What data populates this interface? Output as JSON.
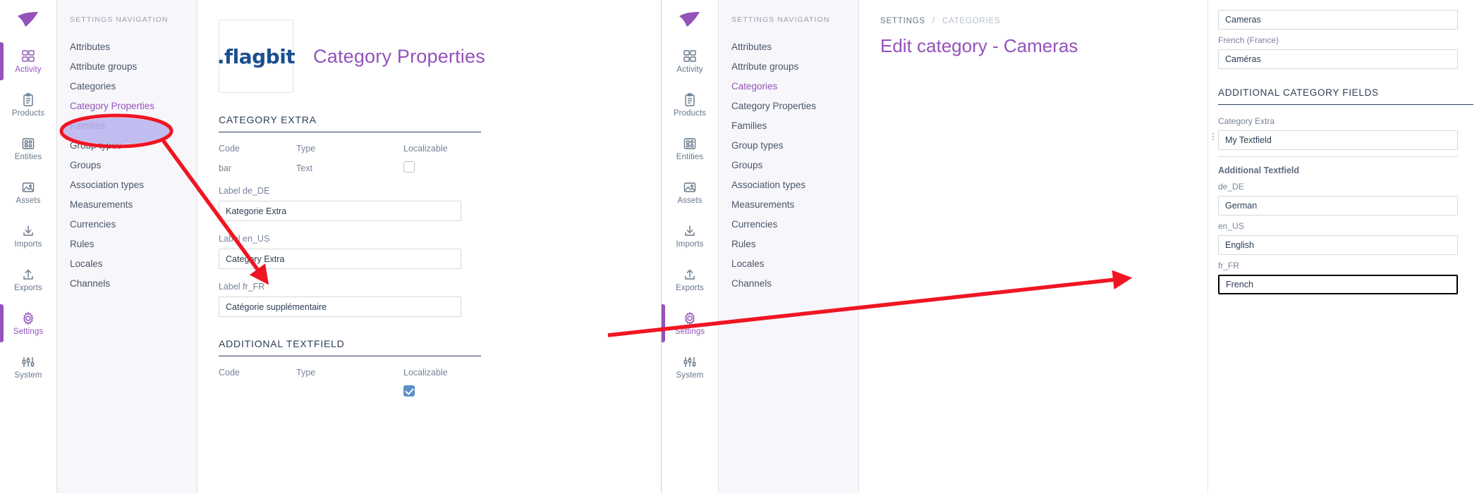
{
  "rail": {
    "logo_name": "akeneo-logo",
    "items": [
      {
        "label": "Activity",
        "icon": "grid-icon",
        "active_left": true,
        "active_right": false
      },
      {
        "label": "Products",
        "icon": "clipboard-icon",
        "active_left": false,
        "active_right": false
      },
      {
        "label": "Entities",
        "icon": "entities-grid-icon",
        "active_left": false,
        "active_right": false
      },
      {
        "label": "Assets",
        "icon": "image-icon",
        "active_left": false,
        "active_right": false
      },
      {
        "label": "Imports",
        "icon": "download-icon",
        "active_left": false,
        "active_right": false
      },
      {
        "label": "Exports",
        "icon": "upload-icon",
        "active_left": false,
        "active_right": false
      },
      {
        "label": "Settings",
        "icon": "gear-icon",
        "active_left": true,
        "active_right": true
      },
      {
        "label": "System",
        "icon": "sliders-icon",
        "active_left": false,
        "active_right": false
      }
    ]
  },
  "settings_nav": {
    "title": "SETTINGS NAVIGATION",
    "items": [
      {
        "label": "Attributes"
      },
      {
        "label": "Attribute groups"
      },
      {
        "label": "Categories"
      },
      {
        "label": "Category Properties"
      },
      {
        "label": "Families"
      },
      {
        "label": "Group types"
      },
      {
        "label": "Groups"
      },
      {
        "label": "Association types"
      },
      {
        "label": "Measurements"
      },
      {
        "label": "Currencies"
      },
      {
        "label": "Rules"
      },
      {
        "label": "Locales"
      },
      {
        "label": "Channels"
      }
    ],
    "active_left_index": 3,
    "active_right_index": 2
  },
  "properties_pane": {
    "logo_label": ".flagbit",
    "title": "Category Properties",
    "sections": [
      {
        "heading": "CATEGORY EXTRA",
        "columns": {
          "code": "Code",
          "type": "Type",
          "localizable": "Localizable"
        },
        "code_value": "bar",
        "type_value": "Text",
        "localizable_checked": false,
        "fields": [
          {
            "label": "Label de_DE",
            "value": "Kategorie Extra",
            "focus": false
          },
          {
            "label": "Label en_US",
            "value": "Category Extra",
            "focus": true
          },
          {
            "label": "Label fr_FR",
            "value": "Catégorie supplémentaire",
            "focus": false
          }
        ]
      },
      {
        "heading": "ADDITIONAL TEXTFIELD",
        "columns": {
          "code": "Code",
          "type": "Type",
          "localizable": "Localizable"
        },
        "code_value": "",
        "type_value": "",
        "localizable_checked": true,
        "fields": []
      }
    ]
  },
  "category_pane": {
    "breadcrumb": {
      "parent": "SETTINGS",
      "separator": "/",
      "current": "CATEGORIES"
    },
    "title": "Edit category - Cameras",
    "form": {
      "top_fields": [
        {
          "label": "",
          "value": "Cameras",
          "focus": false
        },
        {
          "label": "French (France)",
          "value": "Caméras",
          "focus": false
        }
      ],
      "section_heading": "ADDITIONAL CATEGORY FIELDS",
      "category_extra": {
        "label": "Category Extra",
        "value": "My Textfield",
        "focus": false
      },
      "additional_textfield": {
        "group_label": "Additional Textfield",
        "locales": [
          {
            "label": "de_DE",
            "value": "German",
            "focus": false
          },
          {
            "label": "en_US",
            "value": "English",
            "focus": false
          },
          {
            "label": "fr_FR",
            "value": "French",
            "focus": true
          }
        ]
      }
    }
  },
  "annotations": {
    "highlight_target": "Category Properties",
    "arrow_color": "#f01523",
    "ellipse_color": "#f01523",
    "arrow_1": "from Category Properties nav item to Label en_US field",
    "arrow_2": "from Label en_US field to Category Extra value field"
  }
}
